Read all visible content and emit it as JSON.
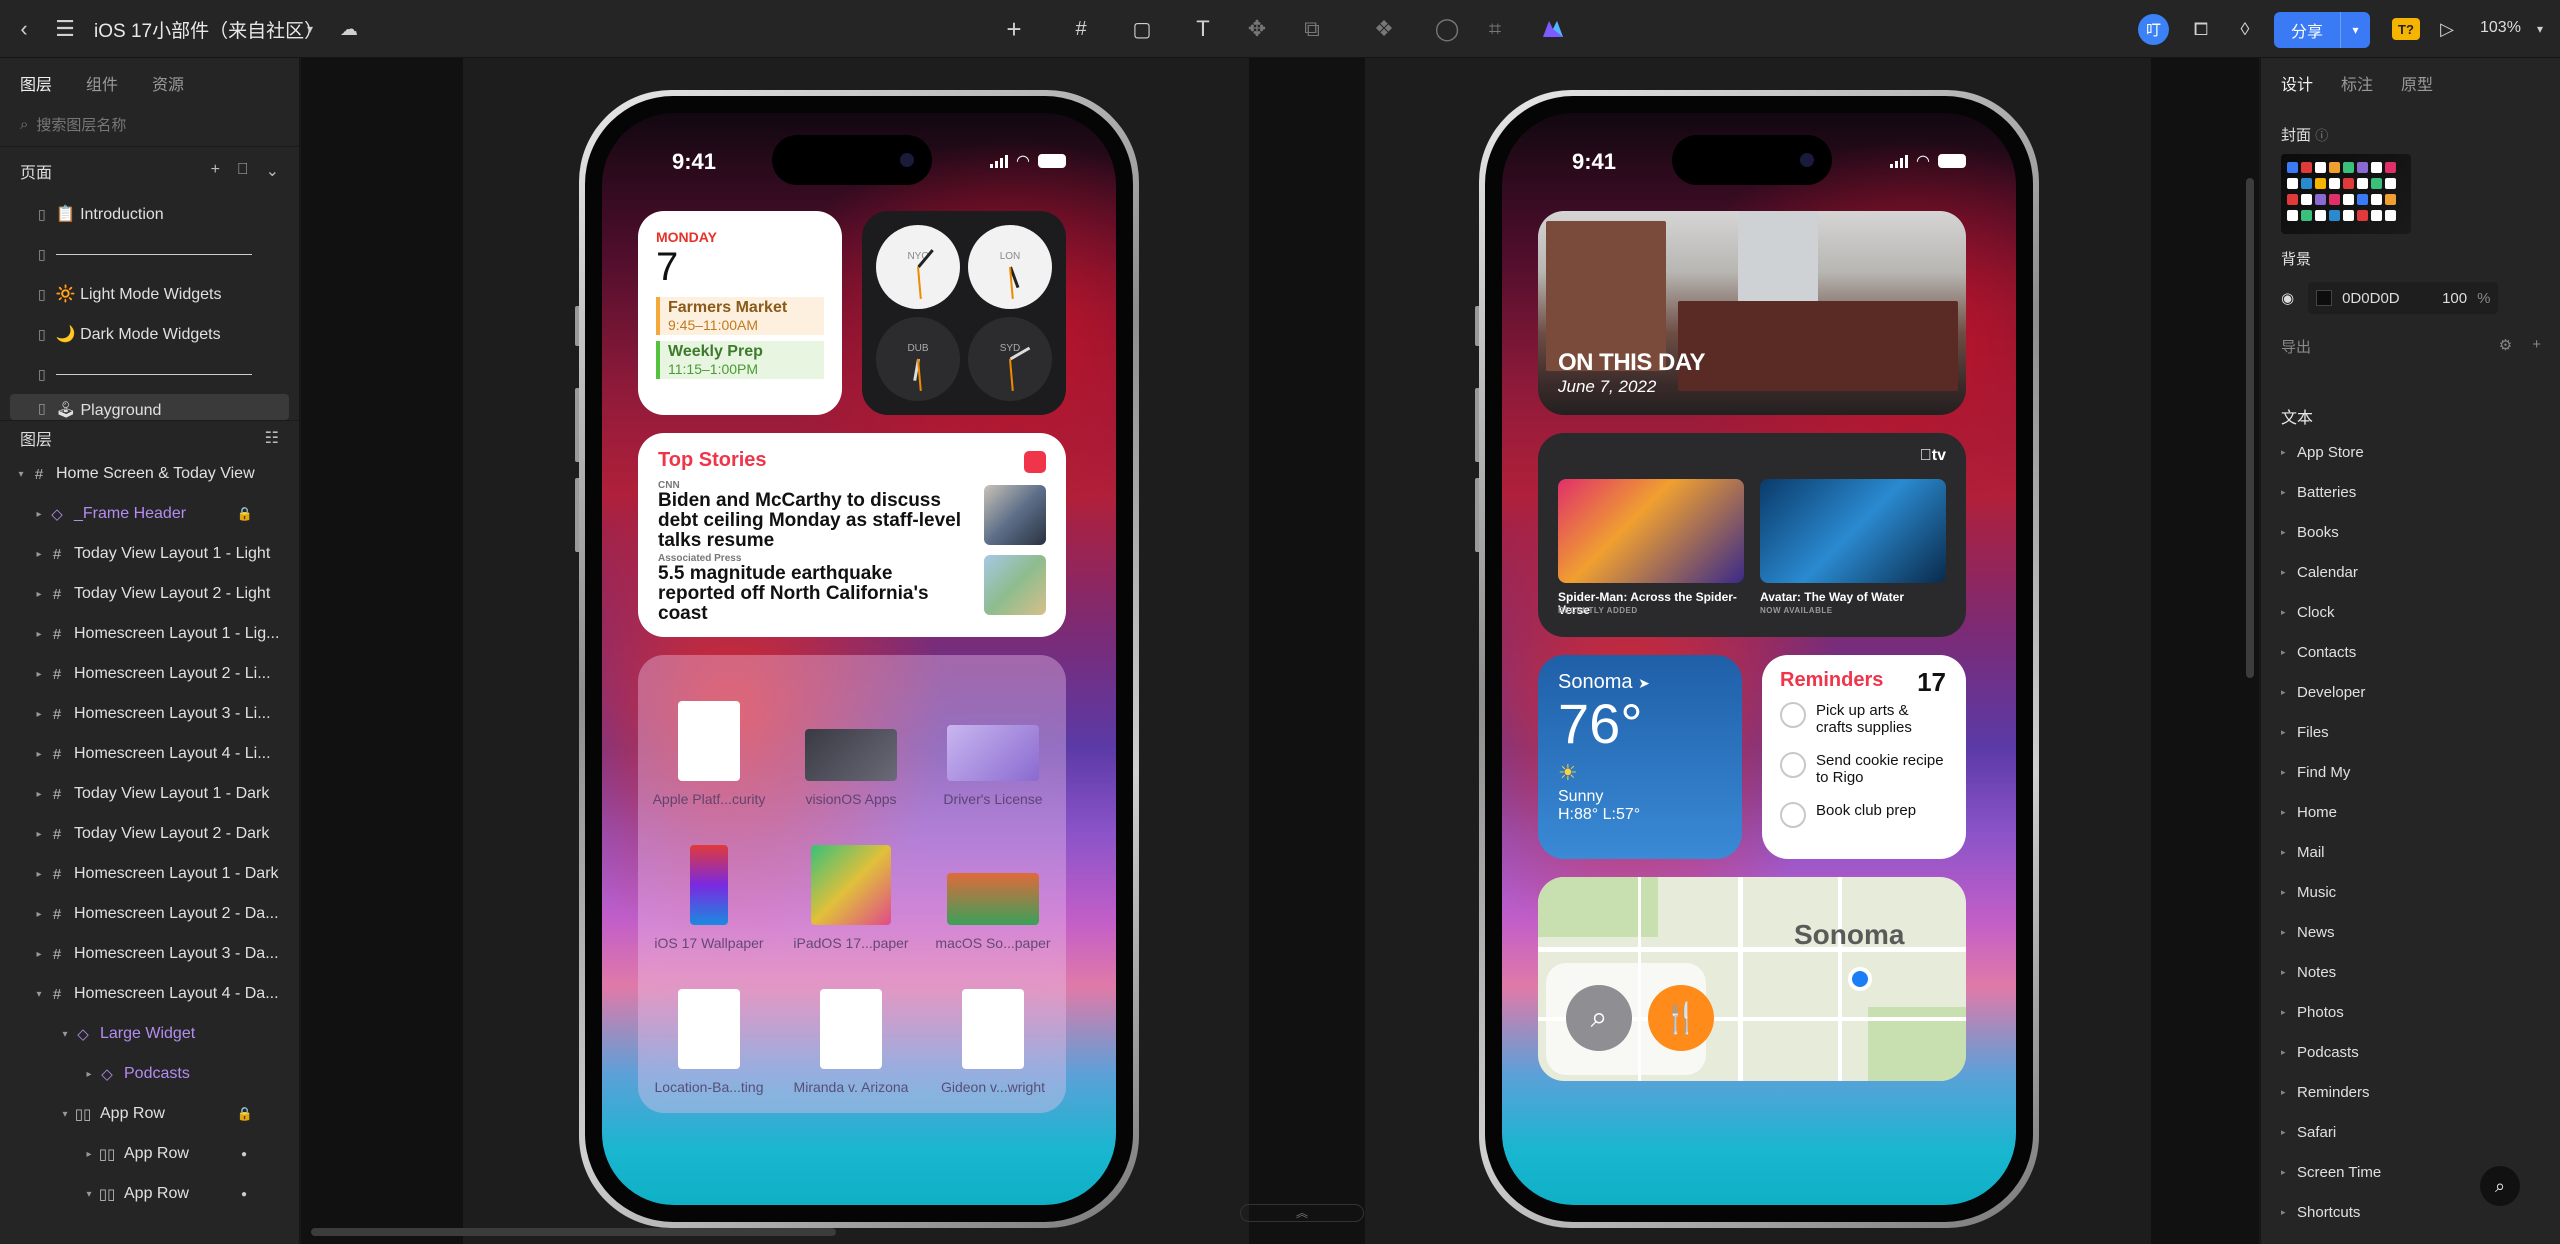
{
  "toolbar": {
    "file_title": "iOS 17小部件（来自社区）",
    "share_label": "分享",
    "avatar_letter": "叮",
    "badge_label": "T?",
    "zoom": "103%"
  },
  "left_panel": {
    "tabs": [
      "图层",
      "组件",
      "资源"
    ],
    "search_placeholder": "搜索图层名称",
    "pages_header": "页面",
    "pages": [
      {
        "label": "📋 Introduction"
      },
      {
        "label": ""
      },
      {
        "label": "🔆 Light Mode Widgets"
      },
      {
        "label": "🌙 Dark Mode Widgets"
      },
      {
        "label": ""
      },
      {
        "label": "🕹 Playground"
      }
    ],
    "layers_header": "图层",
    "layers": [
      {
        "label": "Home Screen & Today View"
      },
      {
        "label": "_Frame Header"
      },
      {
        "label": "Today View Layout 1 - Light"
      },
      {
        "label": "Today View Layout 2 - Light"
      },
      {
        "label": "Homescreen Layout 1 - Lig..."
      },
      {
        "label": "Homescreen Layout 2 - Li..."
      },
      {
        "label": "Homescreen Layout 3 - Li..."
      },
      {
        "label": "Homescreen Layout 4 - Li..."
      },
      {
        "label": "Today View Layout 1 - Dark"
      },
      {
        "label": "Today View Layout 2 - Dark"
      },
      {
        "label": "Homescreen Layout 1 - Dark"
      },
      {
        "label": "Homescreen Layout 2 - Da..."
      },
      {
        "label": "Homescreen Layout 3 - Da..."
      },
      {
        "label": "Homescreen Layout 4 - Da..."
      },
      {
        "label": "Large Widget"
      },
      {
        "label": "Podcasts"
      },
      {
        "label": "App Row"
      },
      {
        "label": "App Row"
      },
      {
        "label": "App Row"
      }
    ]
  },
  "phone_left": {
    "time": "9:41",
    "calendar": {
      "day": "MONDAY",
      "date": "7",
      "events": [
        {
          "title": "Farmers Market",
          "time": "9:45–11:00AM"
        },
        {
          "title": "Weekly Prep",
          "time": "11:15–1:00PM"
        }
      ]
    },
    "clocks": [
      "NYC",
      "LON",
      "DUB",
      "SYD"
    ],
    "news": {
      "header": "Top Stories",
      "source1": "CNN",
      "headline1": "Biden and McCarthy to discuss debt ceiling Monday as staff-level talks resume",
      "source2": "Associated Press",
      "headline2": "5.5 magnitude earthquake reported off North California's coast"
    },
    "files": [
      {
        "label": "Apple Platf...curity"
      },
      {
        "label": "visionOS Apps"
      },
      {
        "label": "Driver's License"
      },
      {
        "label": "iOS 17 Wallpaper"
      },
      {
        "label": "iPadOS 17...paper"
      },
      {
        "label": "macOS So...paper"
      },
      {
        "label": "Location-Ba...ting"
      },
      {
        "label": "Miranda v. Arizona"
      },
      {
        "label": "Gideon v...wright"
      }
    ]
  },
  "phone_right": {
    "time": "9:41",
    "on_this_day": {
      "title": "ON THIS DAY",
      "date": "June 7, 2022"
    },
    "tv": {
      "logo": "tv",
      "items": [
        {
          "title": "Spider-Man: Across the Spider-Verse",
          "sub": "RECENTLY ADDED"
        },
        {
          "title": "Avatar: The Way of Water",
          "sub": "NOW AVAILABLE"
        }
      ]
    },
    "weather": {
      "city": "Sonoma",
      "temp": "76°",
      "condition": "Sunny",
      "hilo": "H:88° L:57°"
    },
    "reminders": {
      "title": "Reminders",
      "count": "17",
      "items": [
        "Pick up arts & crafts supplies",
        "Send cookie recipe to Rigo",
        "Book club prep"
      ]
    },
    "map": {
      "label": "Sonoma"
    }
  },
  "right_panel": {
    "tabs": [
      "设计",
      "标注",
      "原型"
    ],
    "cover_label": "封面",
    "background_label": "背景",
    "background_hex": "0D0D0D",
    "background_opacity": "100",
    "percent": "%",
    "export_label": "导出",
    "text_header": "文本",
    "text_items": [
      "App Store",
      "Batteries",
      "Books",
      "Calendar",
      "Clock",
      "Contacts",
      "Developer",
      "Files",
      "Find My",
      "Home",
      "Mail",
      "Music",
      "News",
      "Notes",
      "Photos",
      "Podcasts",
      "Reminders",
      "Safari",
      "Screen Time",
      "Shortcuts"
    ]
  },
  "colors": {
    "accent": "#3a7bf5",
    "component_purple": "#b48cf0",
    "background_swatch": "#0D0D0D"
  }
}
